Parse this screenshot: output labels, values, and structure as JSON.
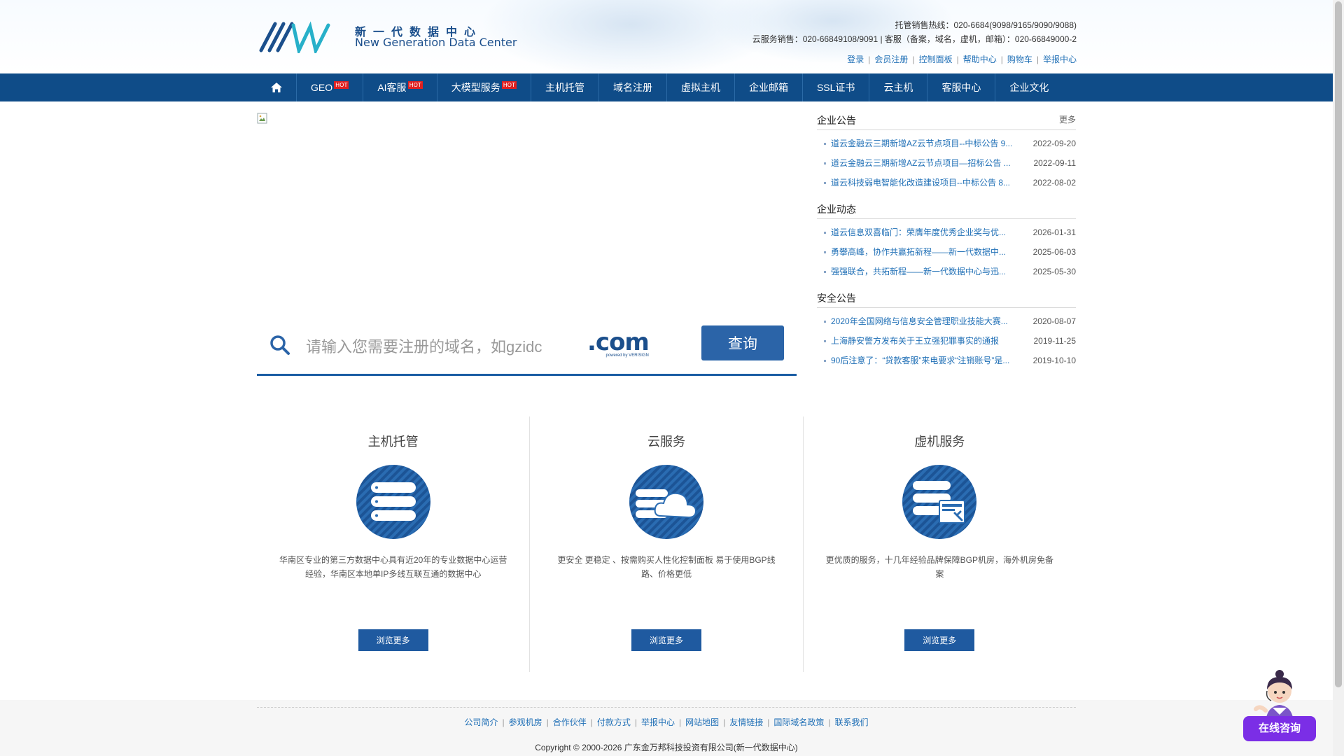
{
  "header": {
    "logo_cn": "新一代数据中心",
    "logo_en": "New Generation Data Center",
    "hosting_hotline": "托管销售热线：020-6684(9098/9165/9090/9088)",
    "cloud_hotline": "云服务销售：020-66849108/9091 | 客服（备案，域名，虚机，邮箱）：020-66849000-2",
    "top_links": [
      "登录",
      "会员注册",
      "控制面板",
      "帮助中心",
      "购物车",
      "举报中心"
    ]
  },
  "nav": {
    "home_icon": "home-icon",
    "hot_badge": "HOT",
    "items": [
      {
        "label": "GEO",
        "hot": true
      },
      {
        "label": "AI客服",
        "hot": true
      },
      {
        "label": "大模型服务",
        "hot": true
      },
      {
        "label": "主机托管",
        "hot": false
      },
      {
        "label": "域名注册",
        "hot": false
      },
      {
        "label": "虚拟主机",
        "hot": false
      },
      {
        "label": "企业邮箱",
        "hot": false
      },
      {
        "label": "SSL证书",
        "hot": false
      },
      {
        "label": "云主机",
        "hot": false
      },
      {
        "label": "客服中心",
        "hot": false
      },
      {
        "label": "企业文化",
        "hot": false
      }
    ]
  },
  "search": {
    "placeholder": "请输入您需要注册的域名，如gzidc",
    "tld": ".com",
    "tld_tagline": "powered by VERISIGN",
    "button": "查询"
  },
  "notices": {
    "more": "更多",
    "sections": [
      {
        "title": "企业公告",
        "items": [
          {
            "text": "道云金融云三期新增AZ云节点项目--中标公告 9...",
            "date": "2022-09-20"
          },
          {
            "text": "道云金融云三期新增AZ云节点项目—招标公告 ...",
            "date": "2022-09-11"
          },
          {
            "text": "道云科技弱电智能化改造建设项目--中标公告 8...",
            "date": "2022-08-02"
          }
        ]
      },
      {
        "title": "企业动态",
        "items": [
          {
            "text": "道云信息双喜临门：荣膺年度优秀企业奖与优...",
            "date": "2026-01-31"
          },
          {
            "text": "勇攀高峰，协作共赢拓新程——新一代数据中...",
            "date": "2025-06-03"
          },
          {
            "text": "强强联合，共拓新程——新一代数据中心与迅...",
            "date": "2025-05-30"
          }
        ]
      },
      {
        "title": "安全公告",
        "items": [
          {
            "text": "2020年全国网络与信息安全管理职业技能大赛...",
            "date": "2020-08-07"
          },
          {
            "text": "上海静安警方发布关于王立强犯罪事实的通报",
            "date": "2019-11-25"
          },
          {
            "text": "90后注意了：“贷款客服”来电要求“注销账号”是...",
            "date": "2019-10-10"
          }
        ]
      }
    ]
  },
  "services": [
    {
      "title": "主机托管",
      "icon": "server-stack-icon",
      "desc": "华南区专业的第三方数据中心具有近20年的专业数据中心运营经验，华南区本地单IP多线互联互通的数据中心",
      "button": "浏览更多"
    },
    {
      "title": "云服务",
      "icon": "cloud-server-icon",
      "desc": "更安全 更稳定 、按需购买人性化控制面板 易于使用BGP线路、价格更低",
      "button": "浏览更多"
    },
    {
      "title": "虚机服务",
      "icon": "virtual-host-icon",
      "desc": "更优质的服务，十几年经验品牌保障BGP机房，海外机房免备案",
      "button": "浏览更多"
    }
  ],
  "footer": {
    "links": [
      "公司简介",
      "参观机房",
      "合作伙伴",
      "付款方式",
      "举报中心",
      "网站地图",
      "友情链接",
      "国际域名政策",
      "联系我们"
    ],
    "copyright": "Copyright © 2000-2026 广东金万邦科技投资有限公司(新一代数据中心)"
  },
  "chat": {
    "label": "在线咨询"
  },
  "colors": {
    "nav_bg": "#0f4c88",
    "accent": "#1f5aa0",
    "link": "#1f6fb6",
    "hot": "#e02020",
    "chat": "#7b2ee6"
  }
}
